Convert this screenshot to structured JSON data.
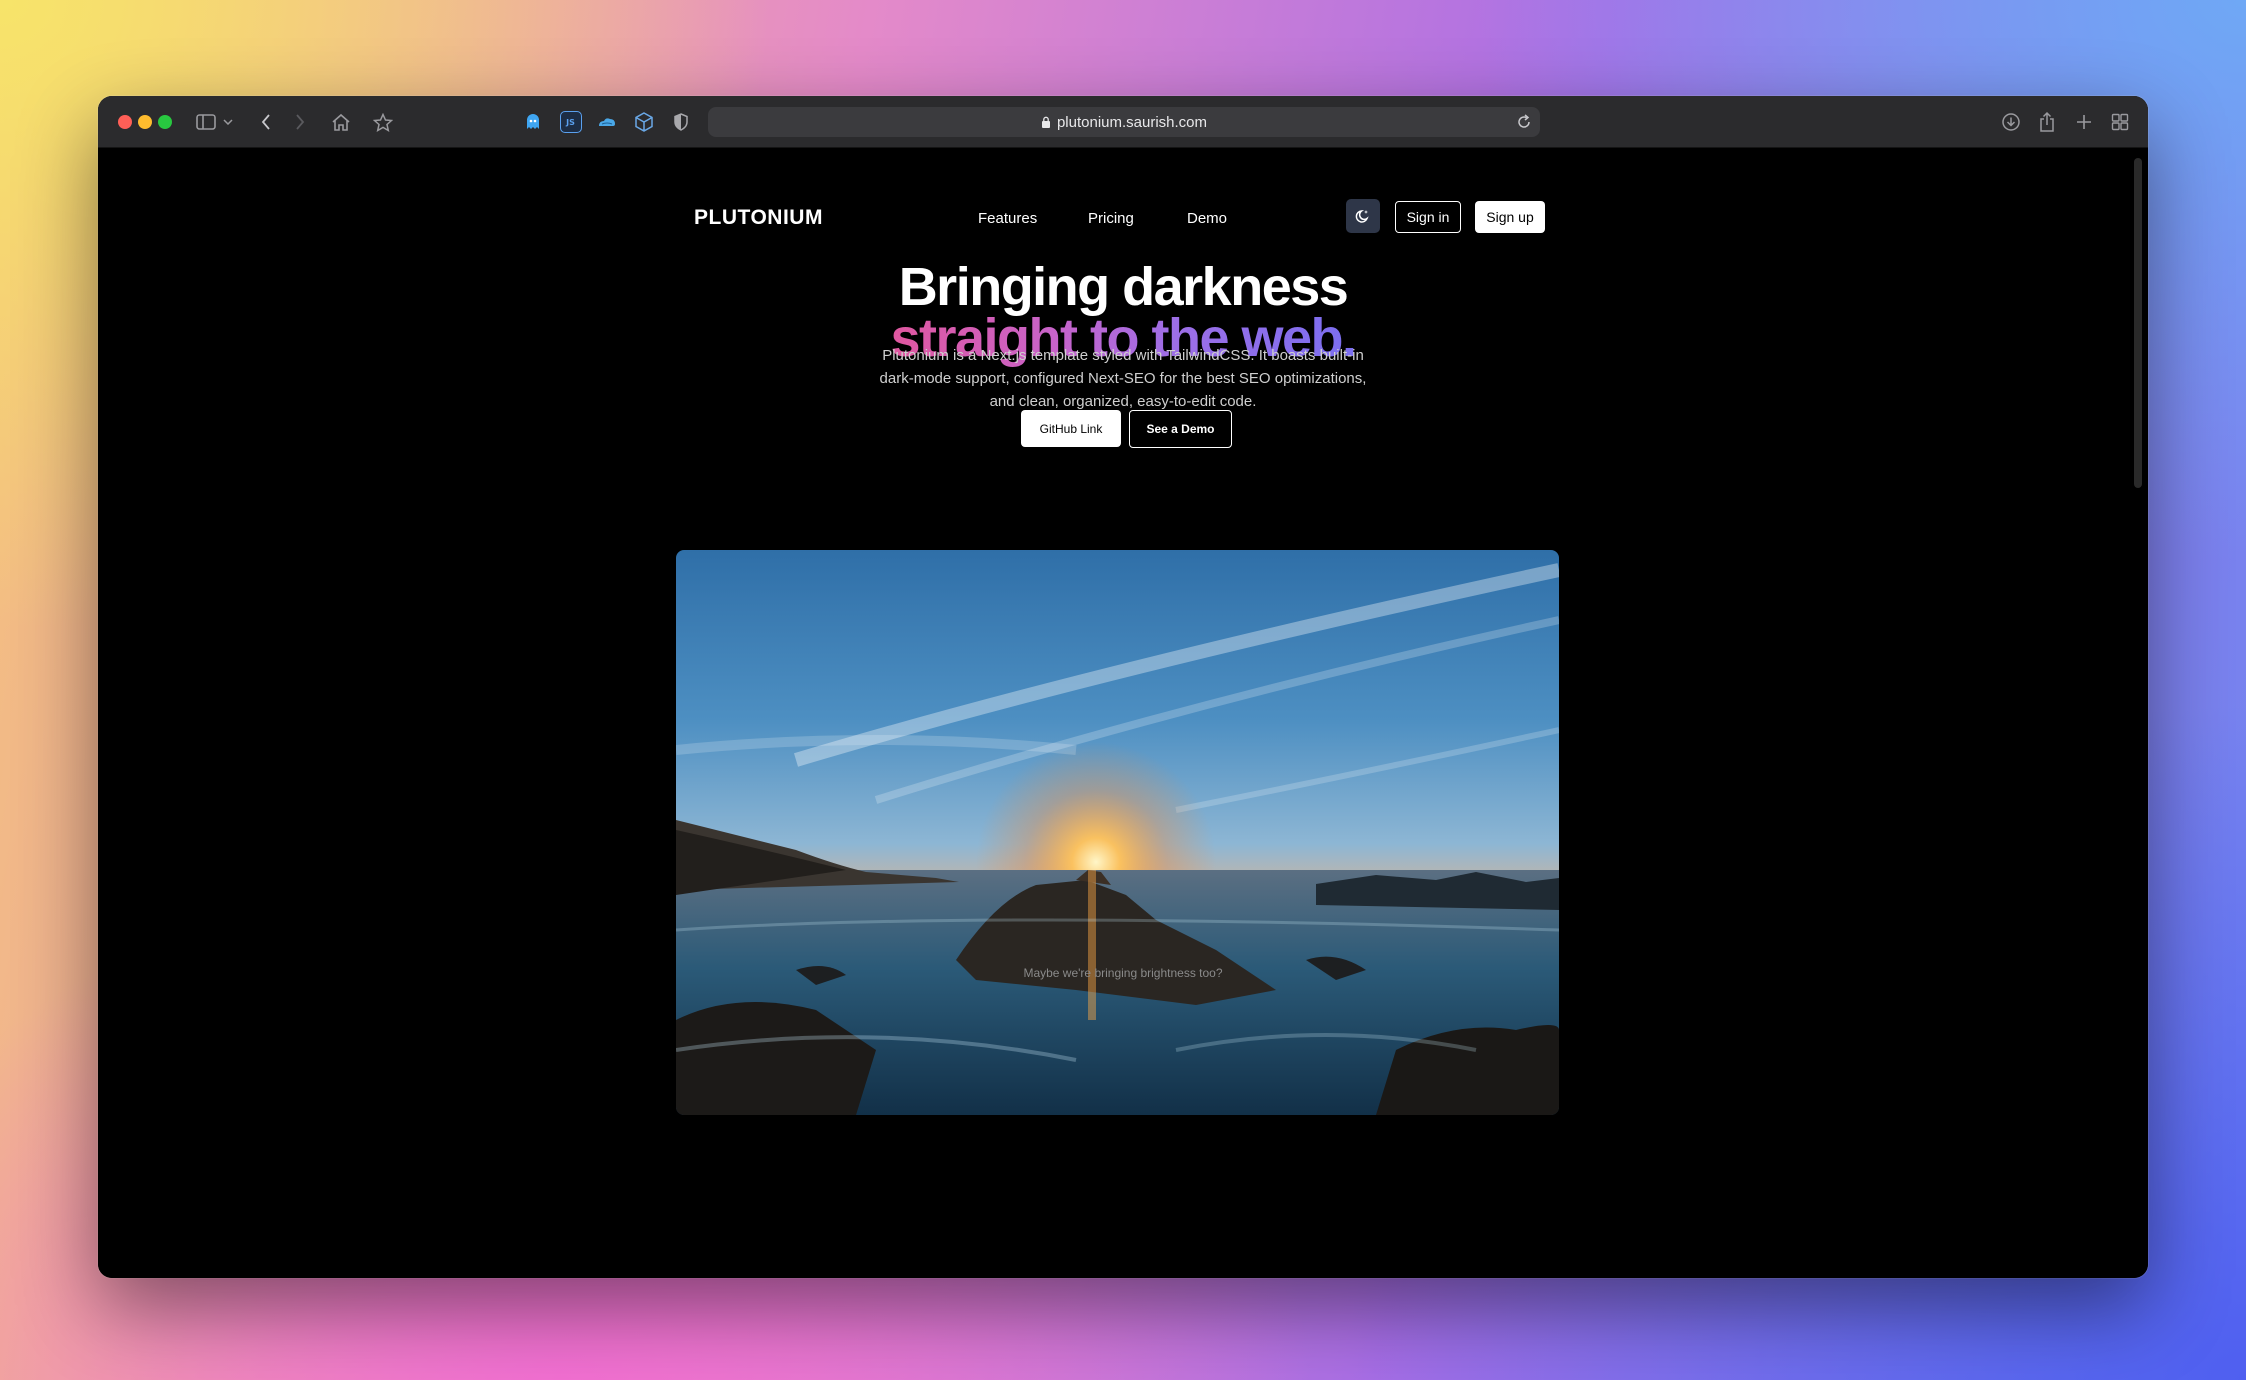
{
  "browser": {
    "url": "plutonium.saurish.com"
  },
  "site": {
    "logo": "PLUTONIUM",
    "nav": [
      {
        "label": "Features"
      },
      {
        "label": "Pricing"
      },
      {
        "label": "Demo"
      }
    ],
    "signin_label": "Sign in",
    "signup_label": "Sign up"
  },
  "hero": {
    "title_line1": "Bringing darkness",
    "title_line2": "straight to the web.",
    "description": "Plutonium is a Next.js template styled with TailwindCSS. It boasts built-in dark-mode support, configured Next-SEO for the best SEO optimizations, and clean, organized, easy-to-edit code.",
    "github_button": "GitHub Link",
    "demo_button": "See a Demo",
    "caption": "Maybe we're bringing brightness too?"
  },
  "colors": {
    "gradient_start": "#e0579f",
    "gradient_end": "#7a6ef0",
    "theme_button_bg": "#2e3648"
  }
}
